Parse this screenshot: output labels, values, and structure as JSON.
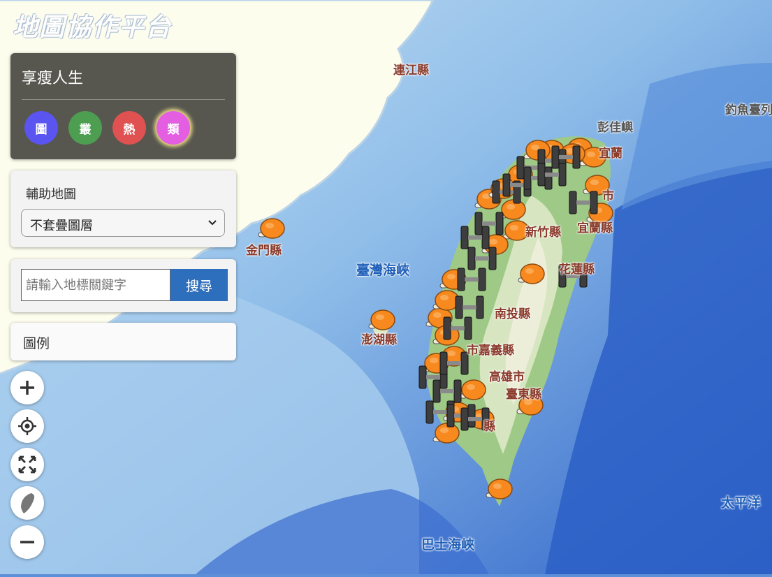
{
  "app": {
    "watermark": "地圖協作平台"
  },
  "theme_panel": {
    "title": "享瘦人生",
    "buttons": [
      {
        "label": "圖",
        "color": "#5a55f0"
      },
      {
        "label": "叢",
        "color": "#4e9e52"
      },
      {
        "label": "熱",
        "color": "#e05252"
      },
      {
        "label": "類",
        "color": "#e35ee0"
      }
    ]
  },
  "basemap": {
    "label": "輔助地圖",
    "selected": "不套疊圖層"
  },
  "search": {
    "placeholder": "請輸入地標關鍵字",
    "button_label": "搜尋"
  },
  "legend": {
    "label": "圖例"
  },
  "map_controls": [
    "zoom-in-icon",
    "locate-icon",
    "fullscreen-icon",
    "taiwan-icon",
    "zoom-out-icon"
  ],
  "map_labels": {
    "lianjiang": "連江縣",
    "jinmen": "金門縣",
    "taiwan_strait": "臺灣海峽",
    "penghu": "澎湖縣",
    "pengjia": "彭佳嶼",
    "diaoyu": "釣魚臺列",
    "yilan": "宜蘭",
    "xinzhu": "新竹縣",
    "taipei": "市",
    "yilan_county": "宜蘭縣",
    "hualian": "花蓮縣",
    "nantou": "南投縣",
    "chiayi": "市嘉義縣",
    "kaohsiung": "高雄市",
    "taidong": "臺東縣",
    "ping": "縣",
    "pacific": "太平洋",
    "bashi": "巴士海峽"
  }
}
